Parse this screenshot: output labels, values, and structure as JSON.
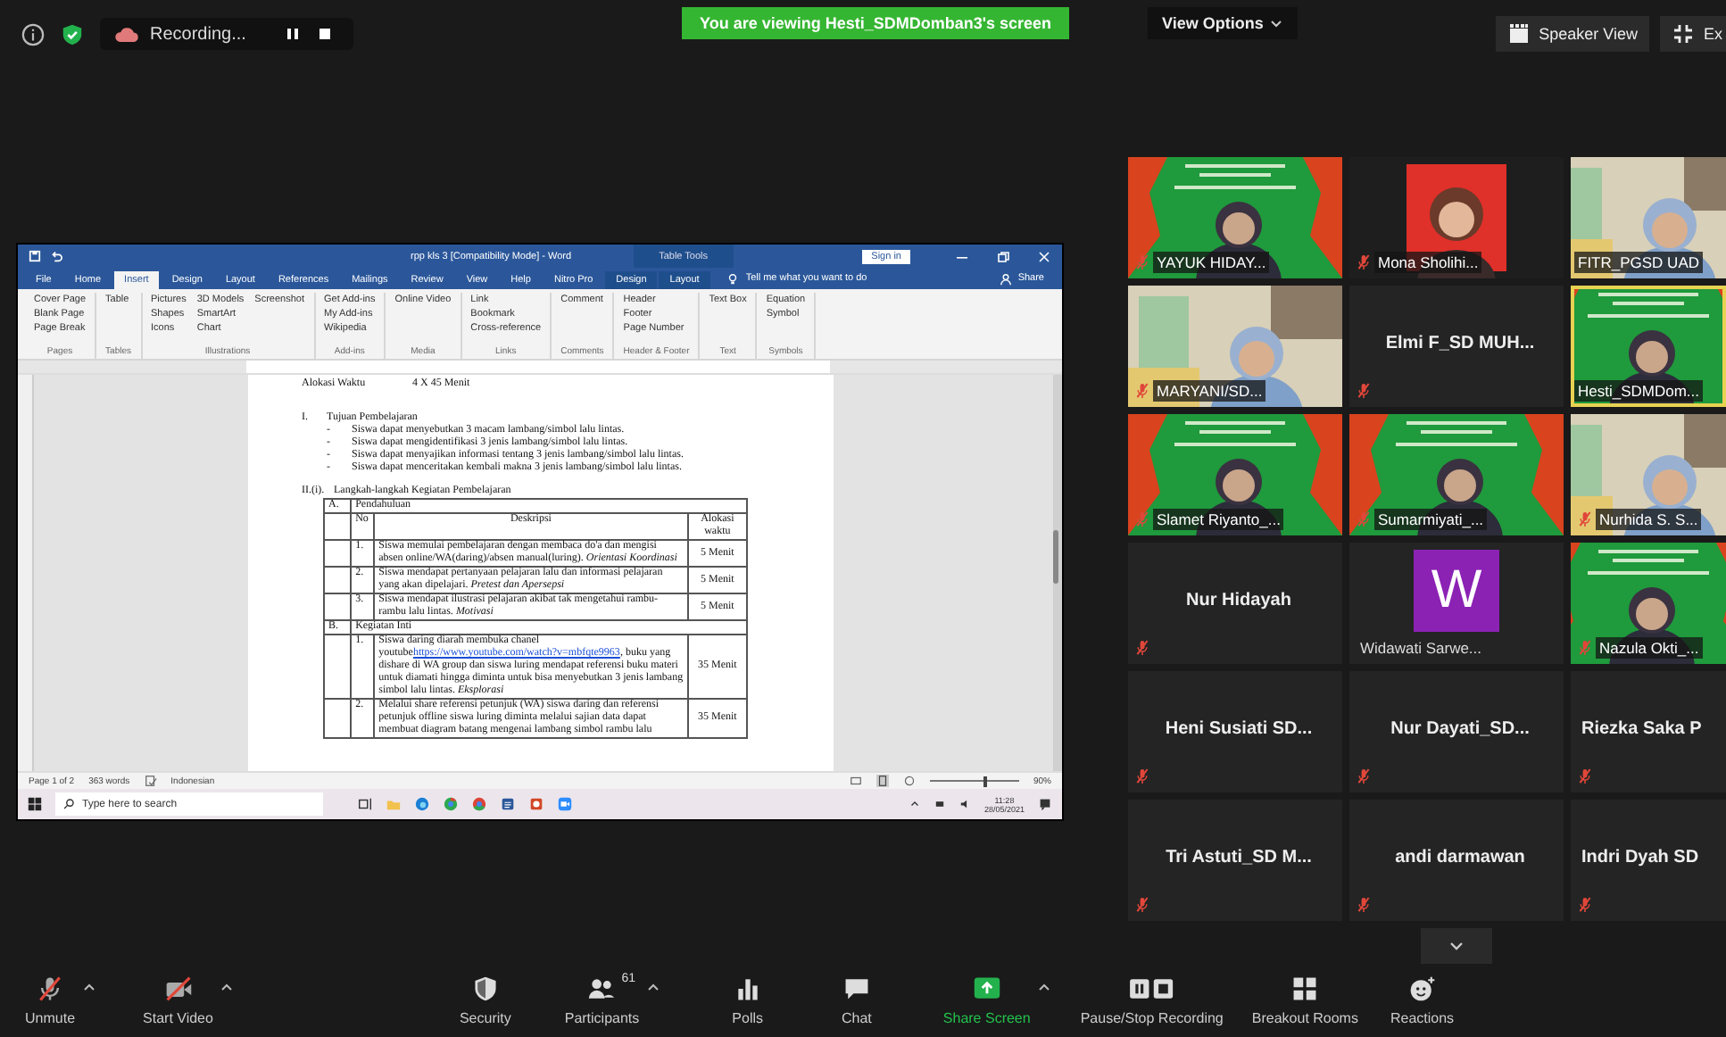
{
  "top_bar": {
    "recording_label": "Recording...",
    "viewing_banner": "You are viewing Hesti_SDMDomban3's screen",
    "view_options": "View Options",
    "speaker_view": "Speaker View",
    "exit_label": "Ex"
  },
  "word": {
    "title": "rpp kls 3 [Compatibility Mode] - Word",
    "context_label": "Table Tools",
    "sign_in": "Sign in",
    "tabs": [
      {
        "label": "File",
        "selected": false
      },
      {
        "label": "Home",
        "selected": false
      },
      {
        "label": "Insert",
        "selected": true
      },
      {
        "label": "Design",
        "selected": false
      },
      {
        "label": "Layout",
        "selected": false
      },
      {
        "label": "References",
        "selected": false
      },
      {
        "label": "Mailings",
        "selected": false
      },
      {
        "label": "Review",
        "selected": false
      },
      {
        "label": "View",
        "selected": false
      },
      {
        "label": "Help",
        "selected": false
      },
      {
        "label": "Nitro Pro",
        "selected": false
      },
      {
        "label": "Design",
        "selected": false
      },
      {
        "label": "Layout",
        "selected": false
      }
    ],
    "tell_me": "Tell me what you want to do",
    "share": "Share",
    "ribbon": [
      {
        "label": "Pages",
        "items": [
          "Cover Page",
          "Blank Page",
          "Page Break"
        ]
      },
      {
        "label": "Tables",
        "items": [
          "Table"
        ]
      },
      {
        "label": "Illustrations",
        "items": [
          "Pictures",
          "Shapes",
          "Icons",
          "3D Models",
          "SmartArt",
          "Chart",
          "Screenshot"
        ]
      },
      {
        "label": "Add-ins",
        "items": [
          "Get Add-ins",
          "My Add-ins",
          "Wikipedia"
        ]
      },
      {
        "label": "Media",
        "items": [
          "Online Video"
        ]
      },
      {
        "label": "Links",
        "items": [
          "Link",
          "Bookmark",
          "Cross-reference"
        ]
      },
      {
        "label": "Comments",
        "items": [
          "Comment"
        ]
      },
      {
        "label": "Header & Footer",
        "items": [
          "Header",
          "Footer",
          "Page Number"
        ]
      },
      {
        "label": "Text",
        "items": [
          "Text Box"
        ]
      },
      {
        "label": "Symbols",
        "items": [
          "Equation",
          "Symbol"
        ]
      }
    ],
    "document": {
      "time_label": "Alokasi Waktu",
      "time_value": "4 X 45 Menit",
      "objectives": {
        "number": "I.",
        "title": "Tujuan Pembelajaran",
        "items": [
          {
            "bullet": "-",
            "text": "Siswa dapat menyebutkan 3 macam lambang/simbol lalu lintas."
          },
          {
            "bullet": "-",
            "text": "Siswa dapat mengidentifikasi 3 jenis lambang/simbol lalu lintas."
          },
          {
            "bullet": "-",
            "text": "Siswa dapat menyajikan informasi tentang 3 jenis lambang/simbol lalu lintas."
          },
          {
            "bullet": "-",
            "text": "Siswa dapat menceritakan kembali makna 3 jenis lambang/simbol lalu lintas."
          }
        ]
      },
      "steps": {
        "number": "II.(i).",
        "title": "Langkah-langkah Kegiatan Pembelajaran",
        "columns": [
          "No",
          "Deskripsi",
          "Alokasi waktu"
        ],
        "sections": [
          {
            "letter": "A.",
            "title": "Pendahuluan",
            "rows": [
              {
                "no": "1.",
                "text": "Siswa memulai pembelajaran dengan membaca do'a dan mengisi absen online/WA(daring)/absen manual(luring). *Orientasi Koordinasi*",
                "time": "5 Menit"
              },
              {
                "no": "2.",
                "text": "Siswa mendapat pertanyaan pelajaran lalu dan informasi pelajaran yang akan dipelajari. *Pretest dan Apersepsi*",
                "time": "5 Menit"
              },
              {
                "no": "3.",
                "text": "Siswa mendapat ilustrasi pelajaran akibat tak mengetahui rambu-rambu lalu lintas. *Motivasi*",
                "time": "5 Menit"
              }
            ]
          },
          {
            "letter": "B.",
            "title": "Kegiatan Inti",
            "rows": [
              {
                "no": "1.",
                "text": "Siswa daring diarah membuka chanel youtube",
                "link": "https://www.youtube.com/watch?v=mbfqte9963",
                "text_after": ", buku yang dishare di WA group dan siswa luring mendapat referensi buku materi untuk diamati hingga diminta untuk bisa menyebutkan 3 jenis lambang simbol lalu lintas. *Eksplorasi*",
                "time": "35 Menit"
              },
              {
                "no": "2.",
                "text": "Melalui share referensi petunjuk (WA) siswa daring dan referensi petunjuk offline siswa luring diminta melalui sajian data dapat membuat diagram batang mengenai lambang simbol rambu lalu",
                "time": "35 Menit"
              }
            ]
          }
        ]
      }
    },
    "status": {
      "page": "Page 1 of 2",
      "words": "363 words",
      "language": "Indonesian",
      "zoom": "90%",
      "zoom_slider": {
        "level": 0.6
      }
    },
    "taskbar": {
      "search_placeholder": "Type here to search",
      "time": "11:28",
      "date": "28/05/2021"
    }
  },
  "gallery": [
    {
      "kind": "video",
      "name": "YAYUK HIDAY...",
      "muted": true,
      "active": false
    },
    {
      "kind": "video",
      "name": "Mona Sholihi...",
      "muted": true,
      "active": false
    },
    {
      "kind": "video",
      "name": "FITR_PGSD UAD",
      "muted": false,
      "active": false
    },
    {
      "kind": "video",
      "name": "MARYANI/SD...",
      "muted": true,
      "active": false
    },
    {
      "kind": "name",
      "name": "Elmi F_SD MUH...",
      "muted": true,
      "active": false
    },
    {
      "kind": "video",
      "name": "Hesti_SDMDom...",
      "muted": false,
      "active": true
    },
    {
      "kind": "video",
      "name": "Slamet Riyanto_...",
      "muted": true,
      "active": false
    },
    {
      "kind": "video",
      "name": "Sumarmiyati_...",
      "muted": true,
      "active": false
    },
    {
      "kind": "video",
      "name": "Nurhida S. S...",
      "muted": true,
      "active": false
    },
    {
      "kind": "name",
      "name": "Nur Hidayah",
      "muted": true,
      "active": false
    },
    {
      "kind": "avatar",
      "letter": "W",
      "name": "Widawati Sarwe...",
      "muted": false,
      "active": false
    },
    {
      "kind": "video",
      "name": "Nazula Okti_...",
      "muted": true,
      "active": false
    },
    {
      "kind": "name",
      "name": "Heni Susiati SD...",
      "muted": true,
      "active": false
    },
    {
      "kind": "name",
      "name": "Nur Dayati_SD...",
      "muted": true,
      "active": false
    },
    {
      "kind": "name",
      "name": "Riezka Saka P",
      "muted": true,
      "active": false
    },
    {
      "kind": "name",
      "name": "Tri Astuti_SD M...",
      "muted": true,
      "active": false
    },
    {
      "kind": "name",
      "name": "andi darmawan",
      "muted": true,
      "active": false
    },
    {
      "kind": "name",
      "name": "Indri Dyah SD",
      "muted": true,
      "active": false
    }
  ],
  "toolbar": [
    {
      "kind": "mic-off",
      "label": "Unmute",
      "caret": true
    },
    {
      "kind": "video-off",
      "label": "Start Video",
      "caret": true
    },
    {
      "kind": "security",
      "label": "Security",
      "caret": false
    },
    {
      "kind": "participants",
      "label": "Participants",
      "count": "61",
      "caret": true
    },
    {
      "kind": "polls",
      "label": "Polls",
      "caret": false
    },
    {
      "kind": "chat",
      "label": "Chat",
      "caret": false
    },
    {
      "kind": "share",
      "label": "Share Screen",
      "caret": true
    },
    {
      "kind": "recording",
      "label": "Pause/Stop Recording",
      "caret": false
    },
    {
      "kind": "breakout",
      "label": "Breakout Rooms",
      "caret": false
    },
    {
      "kind": "reactions",
      "label": "Reactions",
      "caret": false
    }
  ]
}
